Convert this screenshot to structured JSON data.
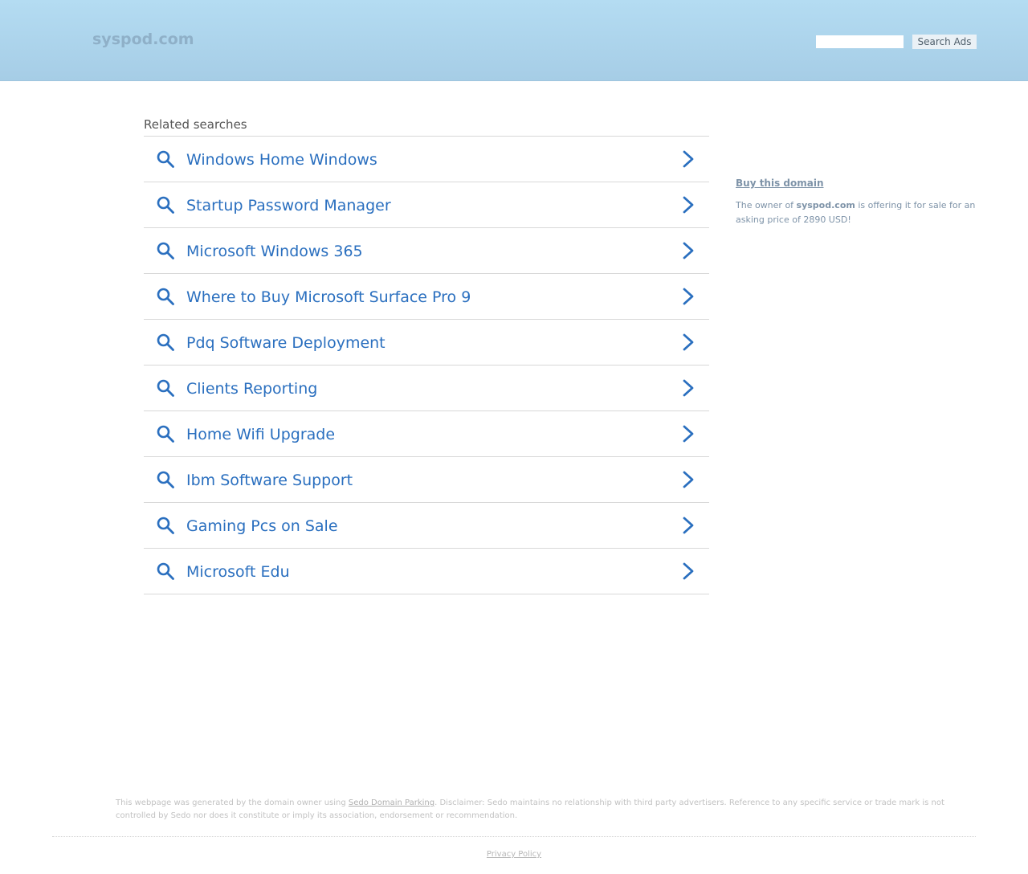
{
  "header": {
    "logo": "syspod.com",
    "search_placeholder": "",
    "search_button": "Search Ads"
  },
  "related": {
    "title": "Related searches",
    "items": [
      {
        "label": "Windows Home Windows"
      },
      {
        "label": "Startup Password Manager"
      },
      {
        "label": "Microsoft Windows 365"
      },
      {
        "label": "Where to Buy Microsoft Surface Pro 9"
      },
      {
        "label": "Pdq Software Deployment"
      },
      {
        "label": "Clients Reporting"
      },
      {
        "label": "Home Wifi Upgrade"
      },
      {
        "label": "Ibm Software Support"
      },
      {
        "label": "Gaming Pcs on Sale"
      },
      {
        "label": "Microsoft Edu"
      }
    ]
  },
  "sidebar": {
    "buy_link": "Buy this domain",
    "offer_prefix": "The owner of ",
    "offer_domain": "syspod.com",
    "offer_suffix": " is offering it for sale for an asking price of 2890 USD!"
  },
  "footer": {
    "disclaimer_prefix": "This webpage was generated by the domain owner using ",
    "disclaimer_link": "Sedo Domain Parking",
    "disclaimer_suffix": ". Disclaimer: Sedo maintains no relationship with third party advertisers. Reference to any specific service or trade mark is not controlled by Sedo nor does it constitute or imply its association, endorsement or recommendation.",
    "privacy": "Privacy Policy"
  },
  "colors": {
    "link_blue": "#2a6fbf",
    "header_top": "#b4dcf2",
    "header_bottom": "#a6cde6"
  }
}
